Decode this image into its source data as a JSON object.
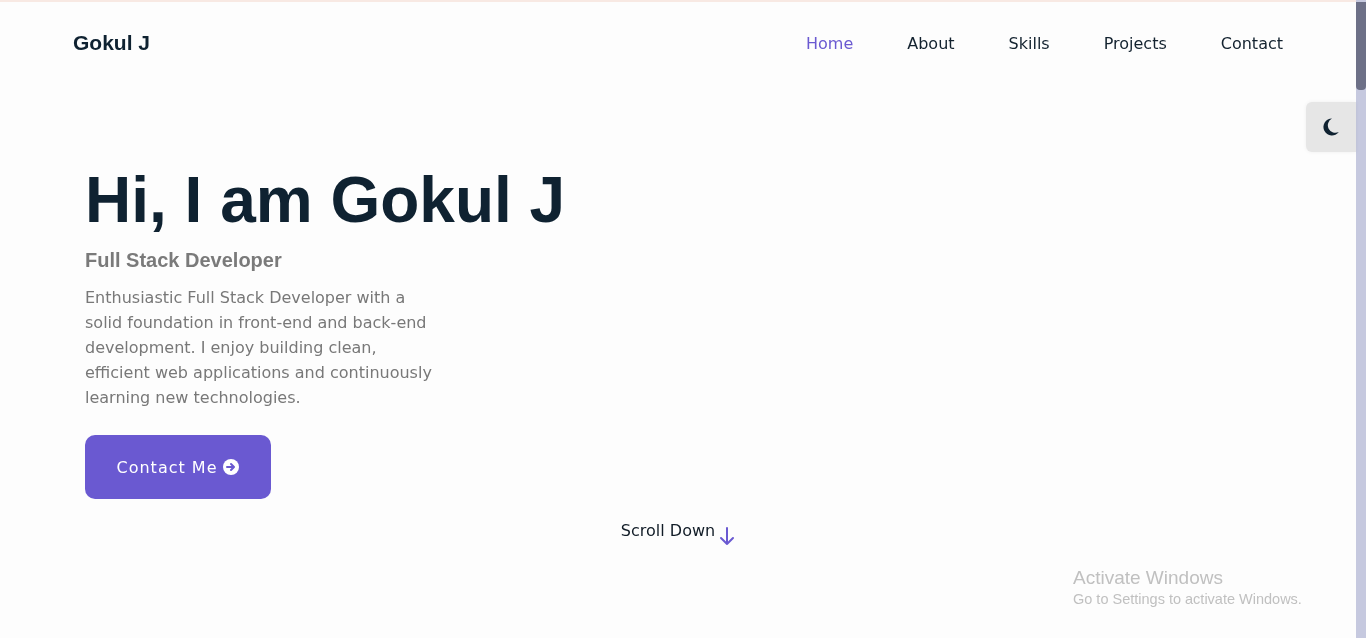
{
  "header": {
    "logo": "Gokul J",
    "nav": [
      {
        "label": "Home",
        "selected": true
      },
      {
        "label": "About",
        "selected": false
      },
      {
        "label": "Skills",
        "selected": false
      },
      {
        "label": "Projects",
        "selected": false
      },
      {
        "label": "Contact",
        "selected": false
      }
    ]
  },
  "hero": {
    "title": "Hi, I am Gokul J",
    "subtitle": "Full Stack Developer",
    "description": "Enthusiastic Full Stack Developer with a solid foundation in front-end and back-end development. I enjoy building clean, efficient web applications and continuously learning new technologies.",
    "cta": "Contact Me"
  },
  "scroll_hint": "Scroll Down",
  "os_overlay": {
    "title": "Activate Windows",
    "message": "Go to Settings to activate Windows."
  }
}
